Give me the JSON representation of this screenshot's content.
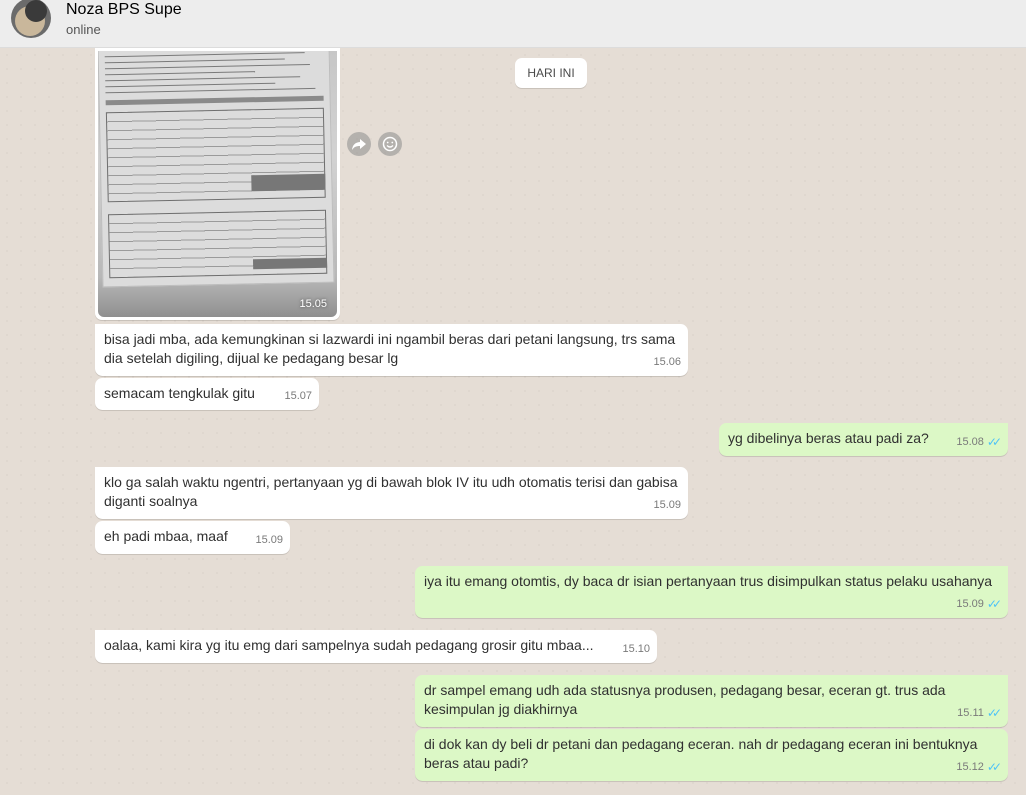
{
  "header": {
    "contact_name": "Noza BPS Supe",
    "status": "online"
  },
  "date_chip": "HARI INI",
  "image_message": {
    "time": "15.05"
  },
  "messages": [
    {
      "dir": "in",
      "text": "bisa jadi mba, ada kemungkinan si lazwardi ini ngambil beras dari petani langsung, trs sama dia setelah digiling, dijual ke pedagang besar lg",
      "time": "15.06"
    },
    {
      "dir": "in",
      "text": "semacam tengkulak gitu",
      "time": "15.07"
    },
    {
      "dir": "out",
      "text": "yg dibelinya beras atau padi za?",
      "time": "15.08",
      "status": "read"
    },
    {
      "dir": "in",
      "text": "klo ga salah waktu ngentri, pertanyaan yg di bawah blok IV itu udh otomatis terisi dan gabisa diganti soalnya",
      "time": "15.09"
    },
    {
      "dir": "in",
      "text": "eh padi mbaa, maaf",
      "time": "15.09"
    },
    {
      "dir": "out",
      "text": "iya itu emang otomtis, dy baca dr isian pertanyaan trus disimpulkan status pelaku usahanya",
      "time": "15.09",
      "status": "read"
    },
    {
      "dir": "in",
      "text": "oalaa, kami kira yg itu emg dari sampelnya sudah pedagang grosir gitu mbaa...",
      "time": "15.10"
    },
    {
      "dir": "out",
      "text": "dr sampel emang udh ada statusnya produsen, pedagang besar, eceran gt. trus ada kesimpulan jg diakhirnya",
      "time": "15.11",
      "status": "read"
    },
    {
      "dir": "out",
      "text": "di dok kan dy beli dr petani dan pedagang eceran. nah dr pedagang eceran ini bentuknya beras atau padi?",
      "time": "15.12",
      "status": "read"
    }
  ],
  "icons": {
    "forward": "forward-icon",
    "emoji": "emoji-icon",
    "read_ticks": "double-check-icon"
  },
  "colors": {
    "incoming_bubble": "#ffffff",
    "outgoing_bubble": "#dcf8c6",
    "chat_background": "#e5ddd5",
    "read_ticks": "#4fc3f7"
  }
}
